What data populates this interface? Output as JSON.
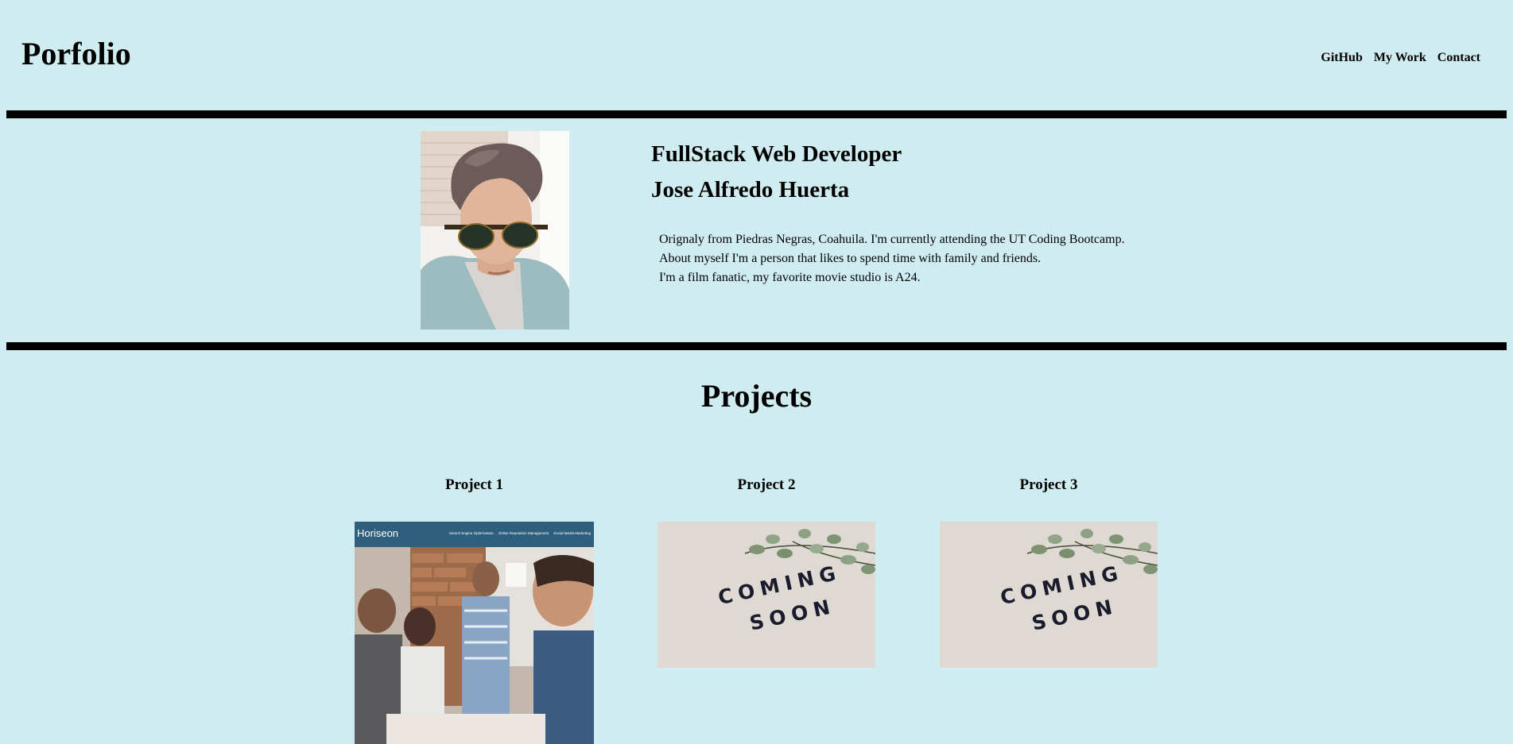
{
  "header": {
    "title": "Porfolio",
    "nav": [
      "GitHub",
      "My Work",
      "Contact"
    ]
  },
  "about": {
    "role": "FullStack Web Developer",
    "name": "Jose Alfredo Huerta",
    "bio": [
      "Orignaly from Piedras Negras, Coahuila. I'm currently attending the UT Coding Bootcamp.",
      "About myself I'm a person that likes to spend time with family and friends.",
      "I'm a film fanatic, my favorite movie studio is A24."
    ]
  },
  "projects": {
    "title": "Projects",
    "items": [
      {
        "title": "Project 1",
        "thumb": {
          "brand": "Horiseon",
          "links": [
            "Search Engine Optimization",
            "Online Reputation Management",
            "Social Media Marketing"
          ]
        }
      },
      {
        "title": "Project 2",
        "thumb": {
          "line1": "COMING",
          "line2": "SOON"
        }
      },
      {
        "title": "Project 3",
        "thumb": {
          "line1": "COMING",
          "line2": "SOON"
        }
      }
    ]
  },
  "colors": {
    "background": "#cfecf1",
    "divider": "#000000",
    "horiseon_bar": "#2e5f7d"
  }
}
